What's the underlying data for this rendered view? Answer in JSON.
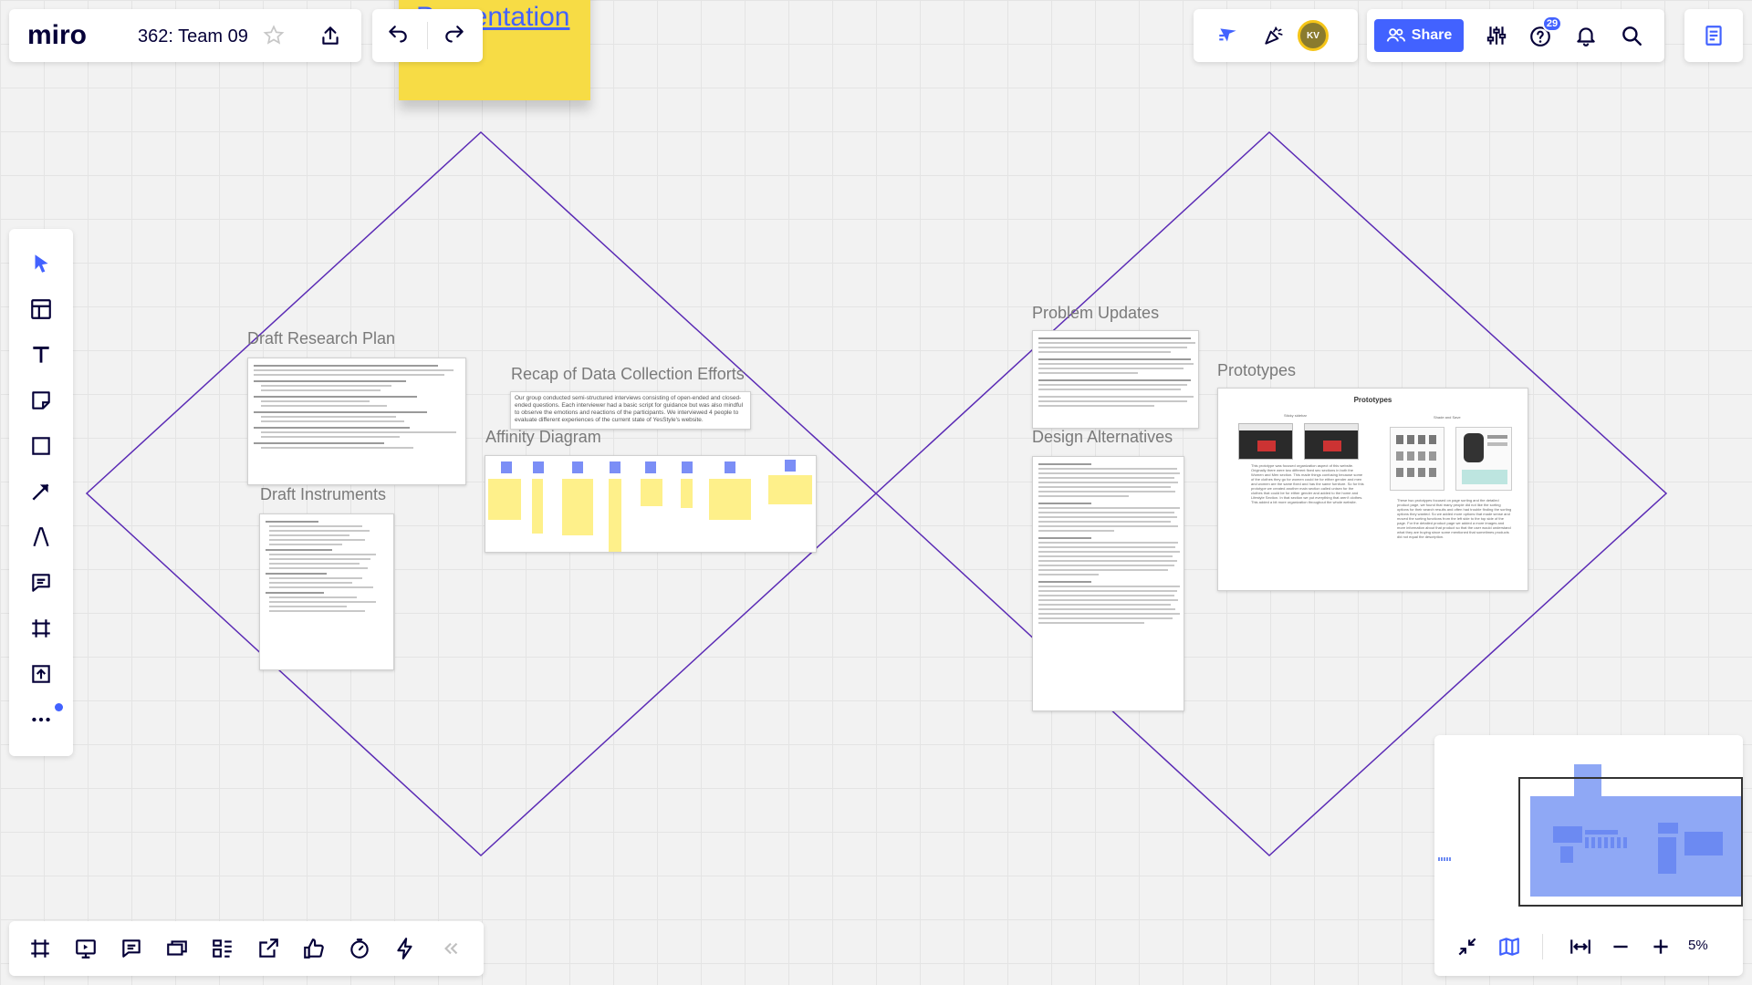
{
  "app": {
    "logo": "miro",
    "board_title": "362: Team 09"
  },
  "header_right": {
    "avatar_initials": "KV",
    "share_label": "Share",
    "help_badge": "29"
  },
  "canvas": {
    "top_sticky_text": "Presentation",
    "frames": {
      "draft_research_plan": "Draft Research Plan",
      "draft_instruments": "Draft Instruments",
      "recap": "Recap of Data Collection Efforts",
      "recap_text": "Our group conducted semi-structured interviews consisting of open-ended and closed-ended questions. Each interviewer had a basic script for guidance but was also mindful to observe the emotions and reactions of the participants. We interviewed 4 people to evaluate different experiences of the current state of YesStyle's website.",
      "affinity": "Affinity Diagram",
      "problem_updates": "Problem Updates",
      "design_alternatives": "Design Alternatives",
      "prototypes": "Prototypes",
      "prototypes_heading": "Prototypes",
      "proto_sub1": "Sticky sidebar",
      "proto_sub2": "Shade and Save",
      "proto_left_text": "This prototype was focused organization aspect of this website. Originally there were two different fixed sec sections in both the Women and Men section. This made things confusing because some of the clothes they go for women could be for either gender and men and women are the same fixed and has the same furniture. So for this prototype we created another main section called unisex for the clothes that could be for either gender and added to the home and Lifestyle Section. In that section we put everything that aren't clothes. This added a bit more organization throughout the whole website.",
      "proto_right_text": "These two prototypes focused on page sorting and the detailed product page, we found that many people did not like the sorting options for their search results and often had trouble finding the sorting options they wanted. So we added more options that made sense and moved the sorting functions from the left side to the top side of the page. For the detailed product page we added a more images and more information about that product so that the user would understand what they are buying since some mentioned that sometimes products did not equal the description."
    }
  },
  "bottom_right": {
    "zoom_label": "5%"
  },
  "colors": {
    "accent": "#4262ff",
    "diamond": "#5b2bb5",
    "sticky": "#f7dc45",
    "minimap_blue": "#8fa8f5"
  },
  "icons": {
    "left_toolbar": [
      "cursor-icon",
      "templates-icon",
      "text-icon",
      "sticky-note-icon",
      "shape-icon",
      "connector-icon",
      "pen-icon",
      "comment-icon",
      "frame-icon",
      "upload-icon",
      "more-icon"
    ],
    "bottom_toolbar": [
      "frames-icon",
      "presentation-icon",
      "comments-icon",
      "cards-icon",
      "kanban-icon",
      "export-icon",
      "voting-icon",
      "timer-icon",
      "activity-icon",
      "collapse-icon"
    ]
  }
}
